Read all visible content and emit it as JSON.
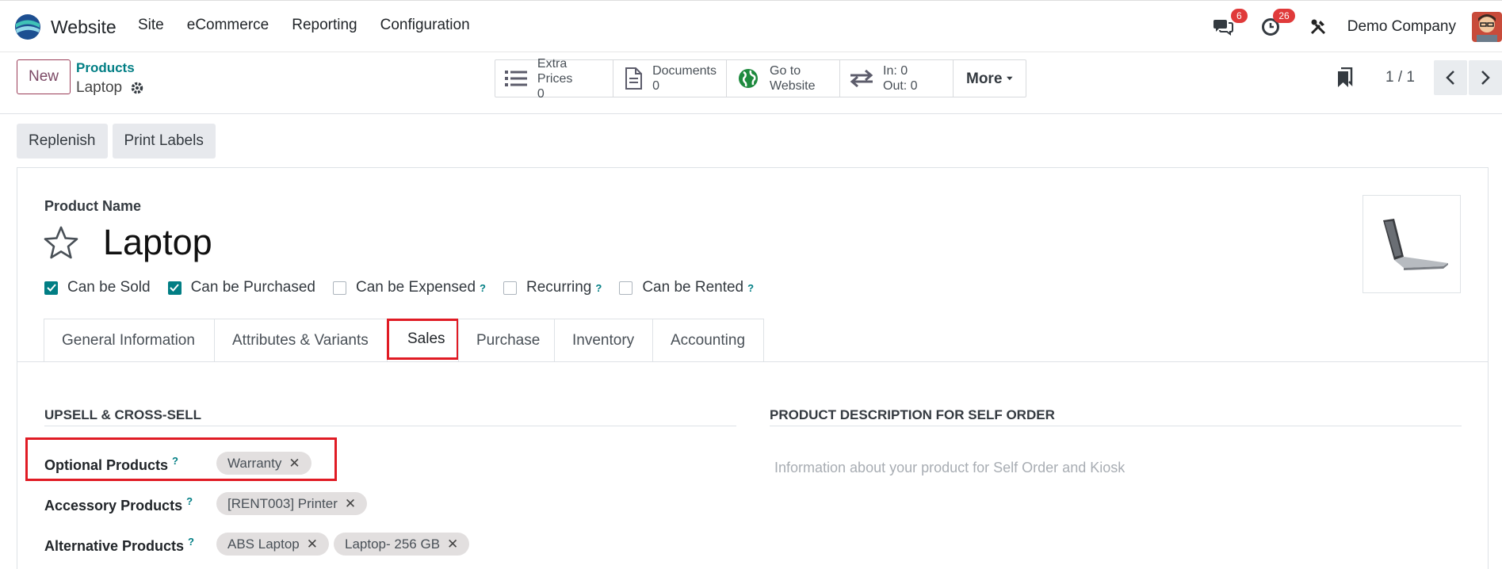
{
  "app": {
    "name": "Website"
  },
  "menu": [
    "Site",
    "eCommerce",
    "Reporting",
    "Configuration"
  ],
  "navbar": {
    "chat_count": "6",
    "activity_count": "26",
    "company": "Demo Company"
  },
  "control": {
    "new_label": "New",
    "breadcrumb_parent": "Products",
    "breadcrumb_current": "Laptop",
    "smart_buttons": [
      {
        "line1": "Extra Prices",
        "line2": "0",
        "icon": "list-icon"
      },
      {
        "line1": "Documents",
        "line2": "0",
        "icon": "document-icon"
      },
      {
        "line1": "Go to",
        "line2": "Website",
        "icon": "globe-icon"
      },
      {
        "line1": "In: 0",
        "line2": "Out: 0",
        "icon": "transfer-arrows-icon"
      }
    ],
    "more_label": "More",
    "pager": "1 / 1"
  },
  "actions": {
    "replenish": "Replenish",
    "print_labels": "Print Labels"
  },
  "form": {
    "name_label": "Product Name",
    "name_value": "Laptop",
    "checkboxes": [
      {
        "label": "Can be Sold",
        "checked": true,
        "help": ""
      },
      {
        "label": "Can be Purchased",
        "checked": true,
        "help": ""
      },
      {
        "label": "Can be Expensed",
        "checked": false,
        "help": "?"
      },
      {
        "label": "Recurring",
        "checked": false,
        "help": "?"
      },
      {
        "label": "Can be Rented",
        "checked": false,
        "help": "?"
      }
    ],
    "tabs": [
      "General Information",
      "Attributes & Variants",
      "Sales",
      "Purchase",
      "Inventory",
      "Accounting"
    ],
    "active_tab": "Sales",
    "upsell_title": "UPSELL & CROSS-SELL",
    "self_order_title": "PRODUCT DESCRIPTION FOR SELF ORDER",
    "self_order_placeholder": "Information about your product for Self Order and Kiosk",
    "optional_label": "Optional Products",
    "optional_tags": [
      "Warranty"
    ],
    "accessory_label": "Accessory Products",
    "accessory_tags": [
      "[RENT003] Printer"
    ],
    "alternative_label": "Alternative Products",
    "alternative_tags": [
      "ABS Laptop",
      "Laptop- 256 GB"
    ],
    "help_mark": "?"
  },
  "colors": {
    "accent": "#017e84",
    "brand": "#714b67",
    "highlight": "#e01b24"
  }
}
